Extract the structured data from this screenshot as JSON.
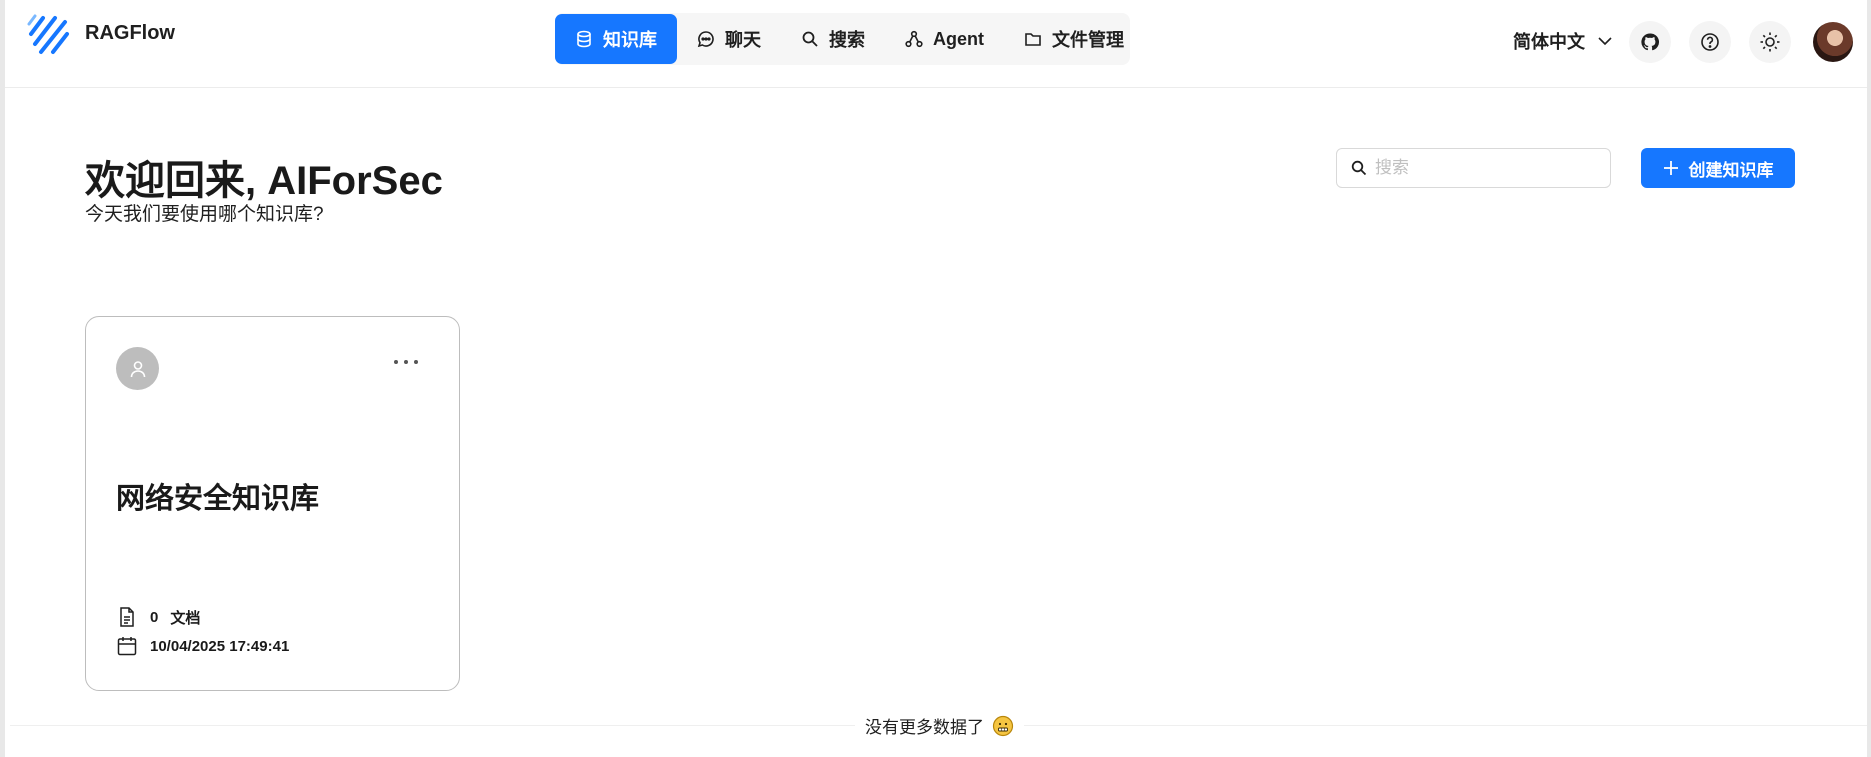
{
  "app": {
    "brand": "RAGFlow"
  },
  "nav": {
    "items": [
      {
        "label": "知识库",
        "icon": "database-icon",
        "active": true
      },
      {
        "label": "聊天",
        "icon": "chat-bubble-icon",
        "active": false
      },
      {
        "label": "搜索",
        "icon": "search-icon",
        "active": false
      },
      {
        "label": "Agent",
        "icon": "agent-graph-icon",
        "active": false
      },
      {
        "label": "文件管理",
        "icon": "folder-icon",
        "active": false
      }
    ]
  },
  "header": {
    "language": "简体中文",
    "icons": [
      "github-icon",
      "help-icon",
      "theme-sun-icon",
      "user-avatar"
    ]
  },
  "main": {
    "welcome": "欢迎回来, AIForSec",
    "subtitle": "今天我们要使用哪个知识库?",
    "search_placeholder": "搜索",
    "create_label": "创建知识库"
  },
  "cards": [
    {
      "title": "网络安全知识库",
      "doc_count": "0",
      "doc_label": "文档",
      "date": "10/04/2025 17:49:41"
    }
  ],
  "footer": {
    "no_more": "没有更多数据了"
  },
  "colors": {
    "accent": "#1677ff"
  }
}
